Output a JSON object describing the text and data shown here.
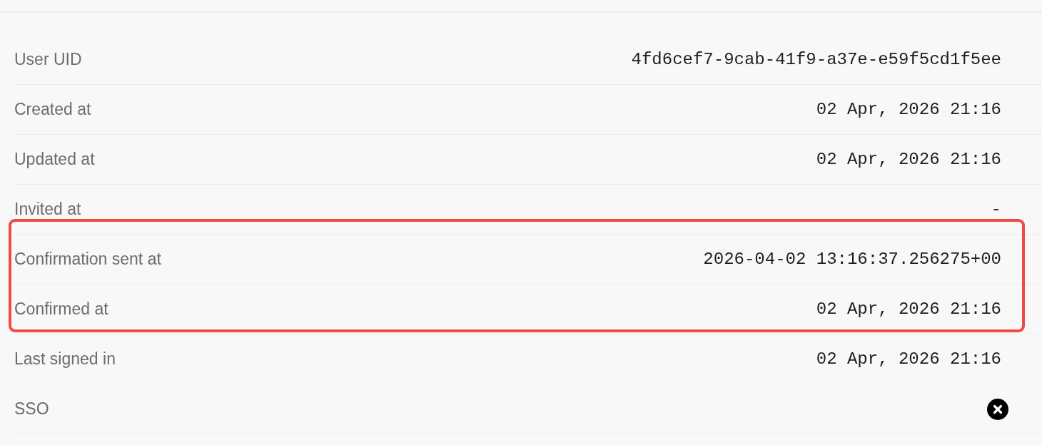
{
  "rows": [
    {
      "label": "User UID",
      "kind": "text",
      "value": "4fd6cef7-9cab-41f9-a37e-e59f5cd1f5ee",
      "highlighted": false
    },
    {
      "label": "Created at",
      "kind": "text",
      "value": "02 Apr, 2026 21:16",
      "highlighted": false
    },
    {
      "label": "Updated at",
      "kind": "text",
      "value": "02 Apr, 2026 21:16",
      "highlighted": false
    },
    {
      "label": "Invited at",
      "kind": "text",
      "value": "-",
      "highlighted": false
    },
    {
      "label": "Confirmation sent at",
      "kind": "text",
      "value": "2026-04-02 13:16:37.256275+00",
      "highlighted": true
    },
    {
      "label": "Confirmed at",
      "kind": "text",
      "value": "02 Apr, 2026 21:16",
      "highlighted": true
    },
    {
      "label": "Last signed in",
      "kind": "text",
      "value": "02 Apr, 2026 21:16",
      "highlighted": false
    },
    {
      "label": "SSO",
      "kind": "flag",
      "on": false,
      "highlighted": false
    }
  ]
}
